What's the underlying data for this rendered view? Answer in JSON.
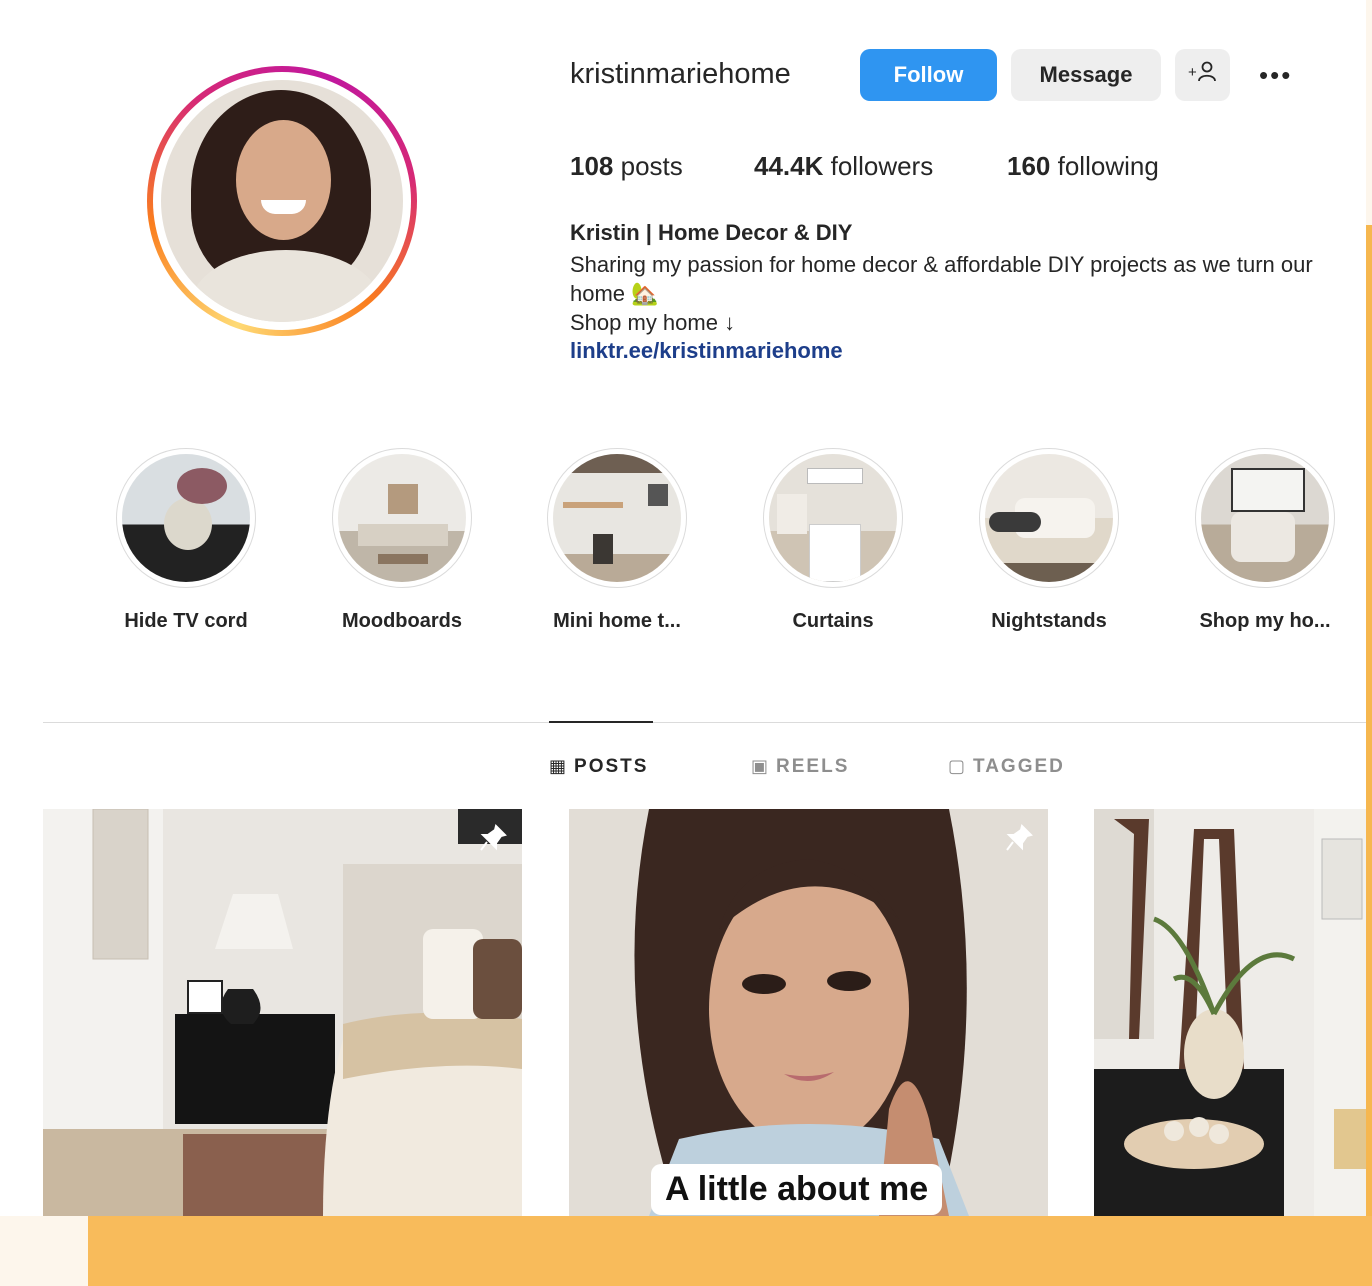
{
  "profile": {
    "username": "kristinmariehome",
    "follow_label": "Follow",
    "message_label": "Message",
    "add_user_label": "+♀",
    "more_label": "•••",
    "stats": {
      "posts_count": "108",
      "posts_label": "posts",
      "followers_count": "44.4K",
      "followers_label": "followers",
      "following_count": "160",
      "following_label": "following"
    },
    "full_name": "Kristin | Home Decor & DIY",
    "bio_line1": "Sharing my passion for home decor & affordable DIY projects as we turn our",
    "bio_line2": "home 🏡",
    "bio_line3": "Shop my home ↓",
    "link": "linktr.ee/kristinmariehome"
  },
  "highlights": [
    {
      "label": "Hide TV cord"
    },
    {
      "label": "Moodboards"
    },
    {
      "label": "Mini home t..."
    },
    {
      "label": "Curtains"
    },
    {
      "label": "Nightstands"
    },
    {
      "label": "Shop my ho..."
    }
  ],
  "tabs": [
    {
      "label": "POSTS",
      "icon": "grid-icon",
      "active": true
    },
    {
      "label": "REELS",
      "icon": "reels-icon",
      "active": false
    },
    {
      "label": "TAGGED",
      "icon": "tagged-icon",
      "active": false
    }
  ],
  "posts": [
    {
      "pinned": true,
      "caption": ""
    },
    {
      "pinned": true,
      "caption": "A little about me"
    },
    {
      "pinned": false,
      "caption": ""
    }
  ],
  "colors": {
    "follow_button": "#2f95f1",
    "link": "#1d3e8a",
    "page_background": "#fdf6ec",
    "accent_band": "#f8bb5b"
  }
}
